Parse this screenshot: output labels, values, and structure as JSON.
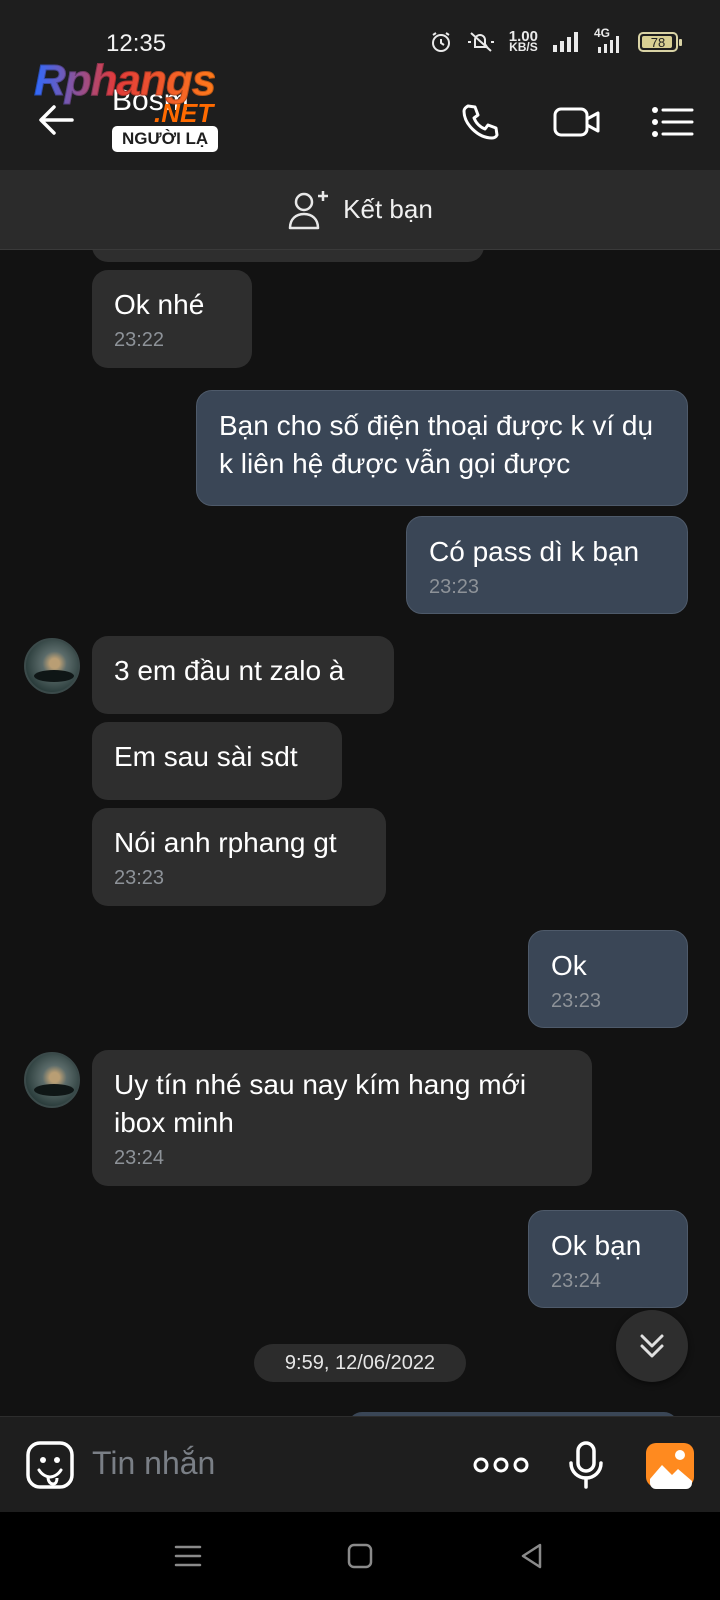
{
  "status_bar": {
    "time": "12:35",
    "speed_value": "1.00",
    "speed_unit": "KB/S",
    "network": "4G",
    "battery": "78"
  },
  "header": {
    "contact_name": "Bosm",
    "badge": "NGƯỜI LẠ",
    "watermark_main": "Rphangs",
    "watermark_sub": ".NET"
  },
  "friend_bar": {
    "label": "Kết bạn"
  },
  "messages": [
    {
      "side": "in",
      "text": "Ok nhé",
      "time": "23:22"
    },
    {
      "side": "out",
      "text": "Bạn cho số điện thoại được k ví dụ k liên hệ được vẫn gọi được",
      "time": ""
    },
    {
      "side": "out",
      "text": "Có pass dì k bạn",
      "time": "23:23"
    },
    {
      "side": "in",
      "text": "3 em đầu nt zalo à",
      "time": ""
    },
    {
      "side": "in",
      "text": "Em sau sài sdt",
      "time": ""
    },
    {
      "side": "in",
      "text": "Nói anh rphang gt",
      "time": "23:23"
    },
    {
      "side": "out",
      "text": "Ok",
      "time": "23:23"
    },
    {
      "side": "in",
      "text": "Uy tín nhé sau nay kím hang mới ibox minh",
      "time": "23:24"
    },
    {
      "side": "out",
      "text": "Ok bạn",
      "time": "23:24"
    }
  ],
  "date_separator": "9:59, 12/06/2022",
  "input": {
    "placeholder": "Tin nhắn"
  },
  "colors": {
    "incoming_bubble": "#2e2e2e",
    "outgoing_bubble": "#3a4656",
    "background": "#121212",
    "accent_orange": "#ff7a1a"
  }
}
